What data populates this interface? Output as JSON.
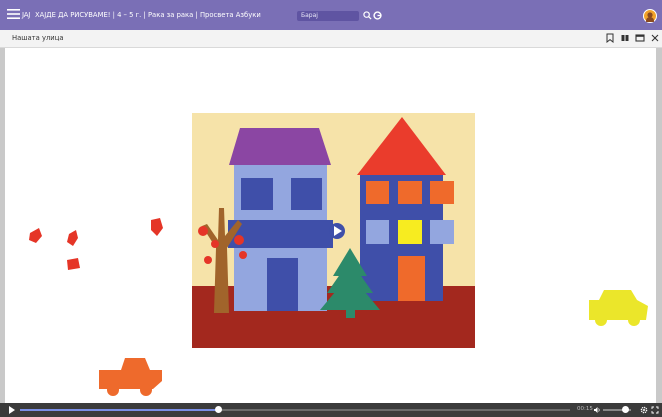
{
  "header": {
    "logo": "ЈАЈ",
    "title": "ХАЈДЕ ДА РИСУВАМЕ! | 4 – 5 г. | Рака за рака | Просвета Азбуки",
    "search_placeholder": "Барај"
  },
  "subbar": {
    "lesson": "Нашата улица"
  },
  "player": {
    "progress": 0.36,
    "volume": 0.8,
    "time": "00:15"
  },
  "colors": {
    "topbar": "#7a6fb6",
    "sky": "#f6e3a9",
    "ground": "#a3281e",
    "roof_left": "#8b46a3",
    "roof_right": "#ea3c2c",
    "house_left": "#93a6df",
    "house_right": "#3f4fa9",
    "window_orange": "#ef6a2b",
    "window_yellow": "#f7ec20",
    "tree": "#2c8a6a",
    "trunk": "#a1642b",
    "car_orange": "#ee6a2c",
    "car_yellow": "#ebe62a"
  },
  "icons": {
    "menu": "hamburger-menu-icon",
    "search": "search-icon",
    "google": "google-icon",
    "bookmark": "bookmark-icon",
    "pages": "pages-icon",
    "window": "window-icon",
    "close": "close-icon",
    "play": "play-icon",
    "volume": "volume-icon",
    "settings": "settings-icon",
    "fullscreen": "fullscreen-icon"
  }
}
